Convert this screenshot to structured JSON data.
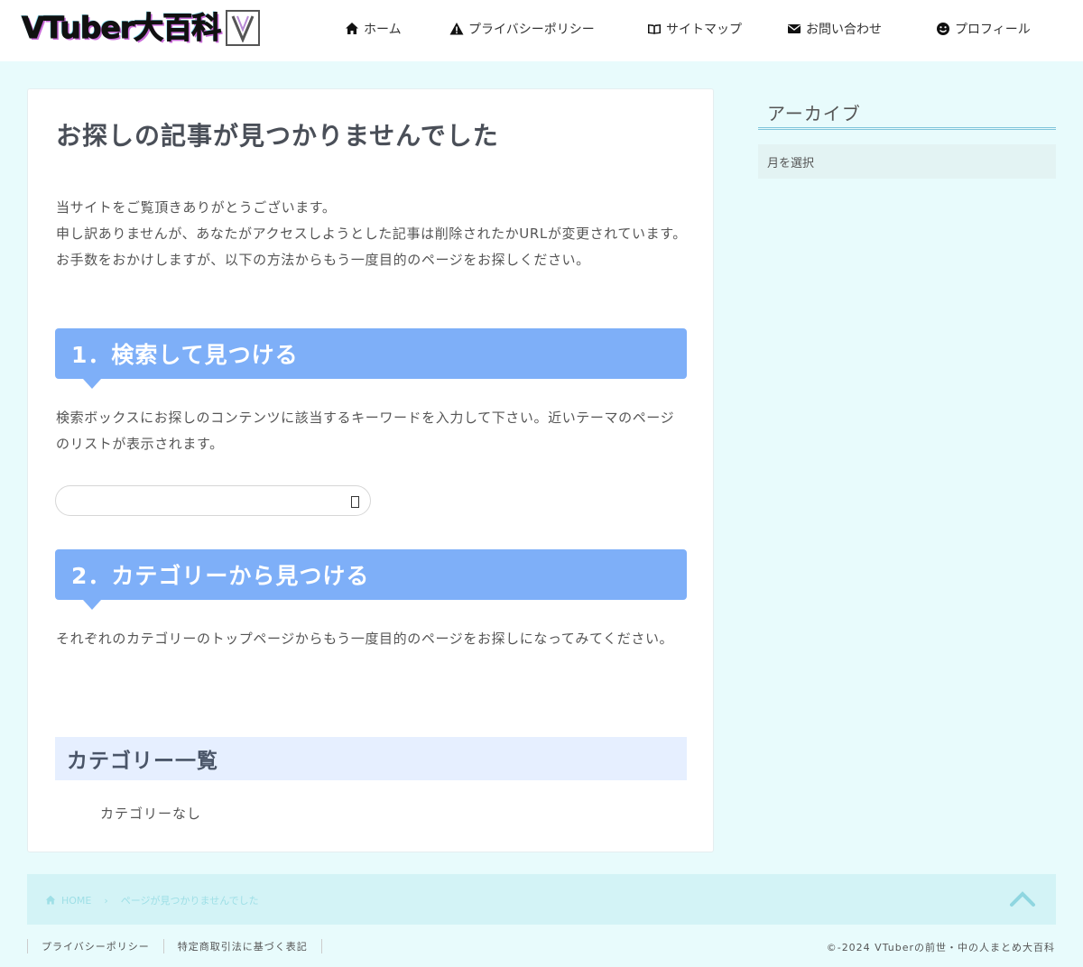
{
  "header": {
    "logo_text": "VTuber大百科",
    "nav": [
      {
        "label": "ホーム",
        "icon": "home-icon"
      },
      {
        "label": "プライバシーポリシー",
        "icon": "warning-icon"
      },
      {
        "label": "サイトマップ",
        "icon": "book-icon"
      },
      {
        "label": "お問い合わせ",
        "icon": "envelope-icon"
      },
      {
        "label": "プロフィール",
        "icon": "smile-icon"
      }
    ]
  },
  "main": {
    "title": "お探しの記事が見つかりませんでした",
    "intro_line1": "当サイトをご覧頂きありがとうございます。",
    "intro_line2": "申し訳ありませんが、あなたがアクセスしようとした記事は削除されたかURLが変更されています。お手数をおかけしますが、以下の方法からもう一度目的のページをお探しください。",
    "section1_heading": "1．検索して見つける",
    "section1_text": "検索ボックスにお探しのコンテンツに該当するキーワードを入力して下さい。近いテーマのページのリストが表示されます。",
    "search_value": "",
    "section2_heading": "2．カテゴリーから見つける",
    "section2_text": "それぞれのカテゴリーのトップページからもう一度目的のページをお探しになってみてください。",
    "category_heading": "カテゴリー一覧",
    "no_category": "カテゴリーなし"
  },
  "sidebar": {
    "archive_title": "アーカイブ",
    "archive_select": "月を選択"
  },
  "breadcrumb": {
    "home": "HOME",
    "current": "ページが見つかりませんでした"
  },
  "footer": {
    "links": [
      "プライバシーポリシー",
      "特定商取引法に基づく表記"
    ],
    "copyright": "©-2024 VTuberの前世・中の人まとめ大百科"
  },
  "colors": {
    "background": "#e8fbfc",
    "heading_blue": "#7eaff8",
    "category_bg": "#e6efff",
    "breadcrumb_bg": "#d3f3f6"
  }
}
